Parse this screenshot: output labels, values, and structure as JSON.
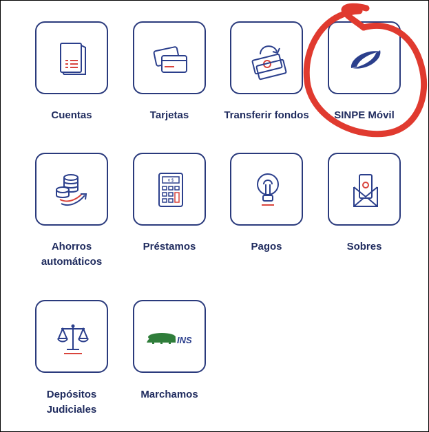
{
  "menu": {
    "items": [
      {
        "label": "Cuentas",
        "icon": "document-list-icon"
      },
      {
        "label": "Tarjetas",
        "icon": "credit-cards-icon"
      },
      {
        "label": "Transferir fondos",
        "icon": "money-transfer-icon"
      },
      {
        "label": "SINPE Móvil",
        "icon": "sinpe-logo-icon"
      },
      {
        "label_line1": "Ahorros",
        "label_line2": "automáticos",
        "icon": "coins-savings-icon"
      },
      {
        "label": "Préstamos",
        "icon": "calculator-icon"
      },
      {
        "label": "Pagos",
        "icon": "lightbulb-icon"
      },
      {
        "label": "Sobres",
        "icon": "envelope-money-icon"
      },
      {
        "label_line1": "Depósitos",
        "label_line2": "Judiciales",
        "icon": "balance-scale-icon"
      },
      {
        "label": "Marchamos",
        "icon": "ins-logo-icon",
        "logo_text": "INS"
      }
    ]
  },
  "colors": {
    "tile_border": "#2a3a7c",
    "icon_blue": "#2b3f8c",
    "accent_red": "#d9443c",
    "ins_green": "#2f7d3a",
    "highlight_red": "#e03a2f"
  }
}
